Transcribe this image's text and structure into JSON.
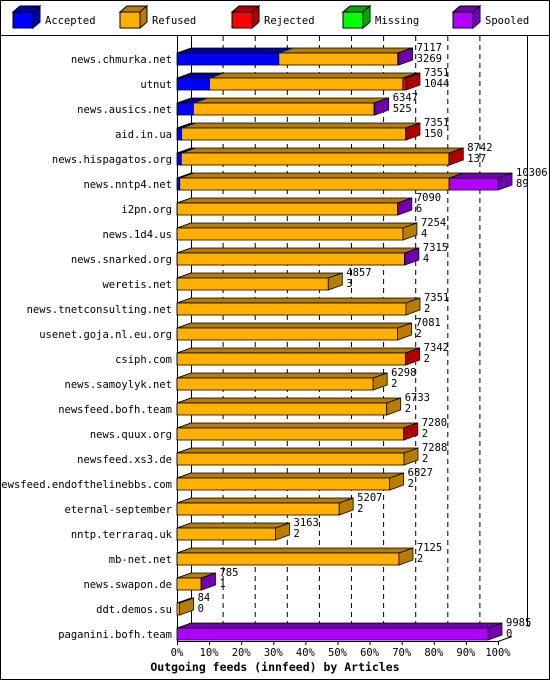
{
  "chart_data": {
    "type": "bar",
    "orientation": "horizontal",
    "stacked": true,
    "title": "",
    "xlabel": "Outgoing feeds (innfeed) by Articles",
    "ylabel": "",
    "xlim": [
      0,
      100
    ],
    "x_ticks": [
      "0%",
      "10%",
      "20%",
      "30%",
      "40%",
      "50%",
      "60%",
      "70%",
      "80%",
      "90%",
      "100%"
    ],
    "grid": true,
    "legend_position": "top",
    "legend": [
      {
        "name": "Accepted",
        "color": "#0000ff",
        "dark": "#0000a8"
      },
      {
        "name": "Refused",
        "color": "#ffb000",
        "dark": "#b87c00"
      },
      {
        "name": "Rejected",
        "color": "#ff0000",
        "dark": "#b00000"
      },
      {
        "name": "Missing",
        "color": "#00ff00",
        "dark": "#00a800"
      },
      {
        "name": "Spooled",
        "color": "#b000ff",
        "dark": "#7000b0"
      }
    ],
    "categories": [
      "news.chmurka.net",
      "utnut",
      "news.ausics.net",
      "aid.in.ua",
      "news.hispagatos.org",
      "news.nntp4.net",
      "i2pn.org",
      "news.1d4.us",
      "news.snarked.org",
      "weretis.net",
      "news.tnetconsulting.net",
      "usenet.goja.nl.eu.org",
      "csiph.com",
      "news.samoylyk.net",
      "newsfeed.bofh.team",
      "news.quux.org",
      "newsfeed.xs3.de",
      "newsfeed.endofthelinebbs.com",
      "eternal-september",
      "nntp.terraraq.uk",
      "mb-net.net",
      "news.swapon.de",
      "ddt.demos.su",
      "paganini.bofh.team"
    ],
    "totals": [
      7117,
      7351,
      6347,
      7351,
      8742,
      10306,
      7090,
      7254,
      7315,
      4857,
      7351,
      7081,
      7342,
      6298,
      6733,
      7280,
      7288,
      6827,
      5207,
      3163,
      7125,
      785,
      84,
      9985
    ],
    "series": [
      {
        "name": "Accepted",
        "values": [
          3269,
          1044,
          525,
          150,
          137,
          89,
          6,
          4,
          4,
          3,
          2,
          2,
          2,
          2,
          2,
          2,
          2,
          2,
          2,
          2,
          2,
          1,
          0,
          0
        ]
      },
      {
        "name": "Refused",
        "values": [
          3818,
          6207,
          5802,
          7191,
          8595,
          8647,
          7074,
          7250,
          7301,
          4854,
          7349,
          7079,
          7330,
          6296,
          6731,
          7268,
          7286,
          6825,
          5205,
          3161,
          7123,
          774,
          84,
          0
        ]
      },
      {
        "name": "Rejected",
        "values": [
          0,
          100,
          0,
          10,
          10,
          0,
          0,
          0,
          0,
          0,
          0,
          0,
          10,
          0,
          0,
          10,
          0,
          0,
          0,
          0,
          0,
          0,
          0,
          0
        ]
      },
      {
        "name": "Missing",
        "values": [
          0,
          0,
          0,
          0,
          0,
          0,
          0,
          0,
          0,
          0,
          0,
          0,
          0,
          0,
          0,
          0,
          0,
          0,
          0,
          0,
          0,
          0,
          0,
          0
        ]
      },
      {
        "name": "Spooled",
        "values": [
          30,
          0,
          20,
          0,
          0,
          1570,
          10,
          0,
          10,
          0,
          0,
          0,
          0,
          0,
          0,
          0,
          0,
          0,
          0,
          0,
          0,
          10,
          0,
          9985
        ]
      }
    ]
  }
}
